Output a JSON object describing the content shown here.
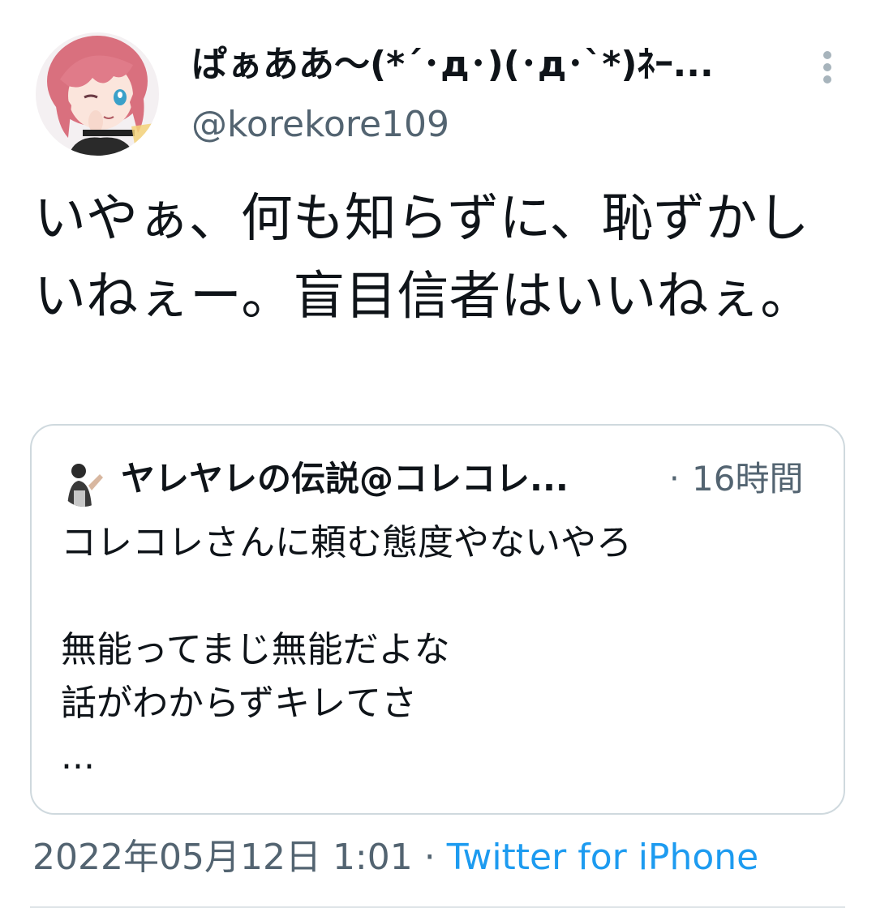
{
  "tweet": {
    "author_display_name": "ぱぁああ〜(*´･д･)(･д･`*)ﾈｰ...",
    "author_handle": "@korekore109",
    "text": "いやぁ、何も知らずに、恥ずかしいねぇー。盲目信者はいいねぇ。",
    "timestamp": "2022年05月12日 1:01",
    "separator": "·",
    "source": "Twitter for iPhone",
    "more_icon": "vertical-dots-icon"
  },
  "quoted_tweet": {
    "author_display_name": "ヤレヤレの伝説@コレコレ...",
    "separator": "·",
    "time_ago": "16時間",
    "lines": [
      "コレコレさんに頼む態度やないやろ",
      "",
      "無能ってまじ無能だよな",
      "話がわからずキレてさ",
      "..."
    ]
  },
  "colors": {
    "text_primary": "#0f1419",
    "text_secondary": "#536471",
    "link_blue": "#1d9bf0",
    "border": "#cfd9de",
    "avatar_hair": "#d9707e"
  }
}
